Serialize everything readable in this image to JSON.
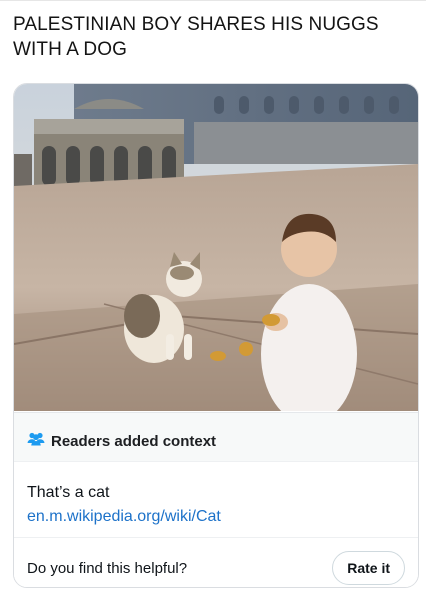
{
  "tweet": {
    "text": "PALESTINIAN BOY SHARES HIS NUGGS WITH A DOG"
  },
  "media": {
    "alt": "photo of a small boy sitting on stone pavement next to a cat with food pieces on the ground, domed building in background"
  },
  "community_note": {
    "header": "Readers added context",
    "header_icon": "people-icon",
    "body_text": "That’s a cat",
    "link_text": "en.m.wikipedia.org/wiki/Cat",
    "helpful_question": "Do you find this helpful?",
    "rate_button": "Rate it",
    "icon_color": "#1d9bf0"
  }
}
